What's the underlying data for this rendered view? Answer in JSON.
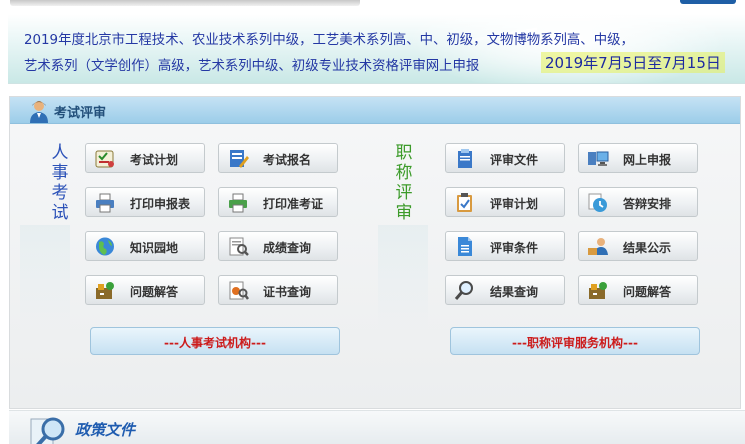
{
  "banner": {
    "line1": "2019年度北京市工程技术、农业技术系列中级，工艺美术系列高、中、初级，文物博物系列高、中级，",
    "line2": "艺术系列（文学创作）高级，艺术系列中级、初级专业技术资格评审网上申报",
    "date": "2019年7月5日至7月15日"
  },
  "panel": {
    "title": "考试评审",
    "left_label": [
      "人",
      "事",
      "考",
      "试"
    ],
    "right_label": [
      "职",
      "称",
      "评",
      "审"
    ],
    "left_buttons": [
      {
        "label": "考试计划",
        "icon": "calendar-checklist-icon"
      },
      {
        "label": "考试报名",
        "icon": "edit-form-icon"
      },
      {
        "label": "打印申报表",
        "icon": "printer-icon"
      },
      {
        "label": "打印准考证",
        "icon": "printer-icon"
      },
      {
        "label": "知识园地",
        "icon": "globe-icon"
      },
      {
        "label": "成绩查询",
        "icon": "score-search-icon"
      },
      {
        "label": "问题解答",
        "icon": "qa-icon"
      },
      {
        "label": "证书查询",
        "icon": "certificate-search-icon"
      }
    ],
    "right_buttons": [
      {
        "label": "评审文件",
        "icon": "document-icon"
      },
      {
        "label": "网上申报",
        "icon": "computer-icon"
      },
      {
        "label": "评审计划",
        "icon": "clipboard-icon"
      },
      {
        "label": "答辩安排",
        "icon": "clock-icon"
      },
      {
        "label": "评审条件",
        "icon": "file-icon"
      },
      {
        "label": "结果公示",
        "icon": "user-announce-icon"
      },
      {
        "label": "结果查询",
        "icon": "magnifier-icon"
      },
      {
        "label": "问题解答",
        "icon": "qa-icon"
      }
    ],
    "left_footer": "---人事考试机构---",
    "right_footer": "---职称评审服务机构---"
  },
  "policy": {
    "title": "政策文件"
  },
  "colors": {
    "banner_text": "#2438a4",
    "header_bg": "#9ccde9",
    "left_label": "#2c52b8",
    "right_label": "#3c9b2a",
    "footer_text": "#cc1b1b"
  }
}
